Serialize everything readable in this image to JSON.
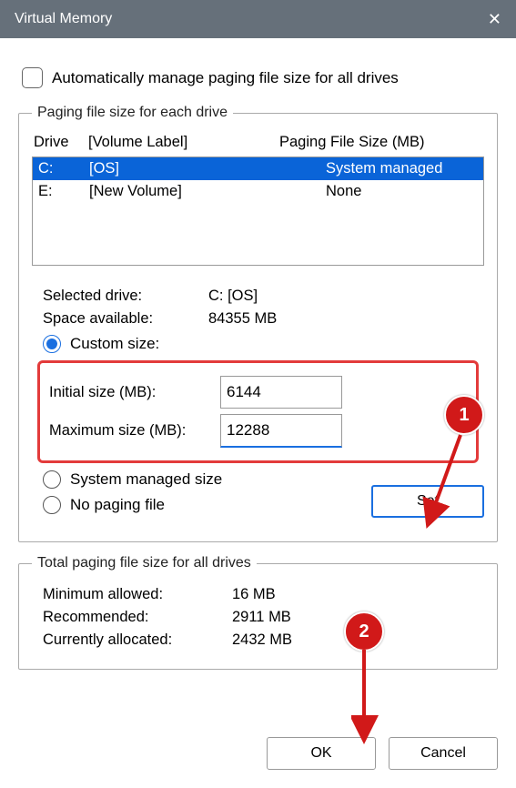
{
  "title": "Virtual Memory",
  "autoLabel": "Automatically manage paging file size for all drives",
  "group1": "Paging file size for each drive",
  "head": {
    "drive": "Drive",
    "vol": "[Volume Label]",
    "size": "Paging File Size (MB)"
  },
  "drives": [
    {
      "d": "C:",
      "v": "[OS]",
      "s": "System managed"
    },
    {
      "d": "E:",
      "v": "[New Volume]",
      "s": "None"
    }
  ],
  "sel": {
    "labDrive": "Selected drive:",
    "valDrive": "C:  [OS]",
    "labSpace": "Space available:",
    "valSpace": "84355 MB"
  },
  "radios": {
    "custom": "Custom size:",
    "sys": "System managed size",
    "none": "No paging file"
  },
  "size": {
    "initLab": "Initial size (MB):",
    "initVal": "6144",
    "maxLab": "Maximum size (MB):",
    "maxVal": "12288"
  },
  "setBtn": "Set",
  "group2": "Total paging file size for all drives",
  "totals": {
    "minLab": "Minimum allowed:",
    "minVal": "16 MB",
    "recLab": "Recommended:",
    "recVal": "2911 MB",
    "curLab": "Currently allocated:",
    "curVal": "2432 MB"
  },
  "ok": "OK",
  "cancel": "Cancel",
  "annot": {
    "b1": "1",
    "b2": "2"
  }
}
